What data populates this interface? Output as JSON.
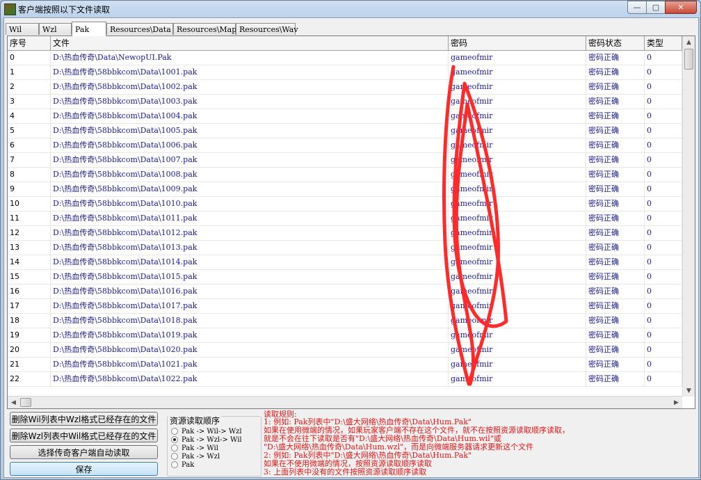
{
  "window": {
    "title": "客户端按照以下文件读取",
    "controls": {
      "minimize": "—",
      "maximize": "▢",
      "close": "✕"
    }
  },
  "tabs": [
    {
      "label": "Wil",
      "active": false
    },
    {
      "label": "Wzl",
      "active": false
    },
    {
      "label": "Pak",
      "active": true
    },
    {
      "label": "Resources\\Data",
      "active": false
    },
    {
      "label": "Resources\\Map",
      "active": false
    },
    {
      "label": "Resources\\Wav",
      "active": false
    }
  ],
  "grid": {
    "columns": [
      "序号",
      "文件",
      "密码",
      "密码状态",
      "类型"
    ],
    "rows": [
      [
        "0",
        "D:\\热血传奇\\Data\\NewopUI.Pak",
        "gameofmir",
        "密码正确",
        "0"
      ],
      [
        "1",
        "D:\\热血传奇\\58bbkcom\\Data\\1001.pak",
        "gameofmir",
        "密码正确",
        "0"
      ],
      [
        "2",
        "D:\\热血传奇\\58bbkcom\\Data\\1002.pak",
        "gameofmir",
        "密码正确",
        "0"
      ],
      [
        "3",
        "D:\\热血传奇\\58bbkcom\\Data\\1003.pak",
        "gameofmir",
        "密码正确",
        "0"
      ],
      [
        "4",
        "D:\\热血传奇\\58bbkcom\\Data\\1004.pak",
        "gameofmir",
        "密码正确",
        "0"
      ],
      [
        "5",
        "D:\\热血传奇\\58bbkcom\\Data\\1005.pak",
        "gameofmir",
        "密码正确",
        "0"
      ],
      [
        "6",
        "D:\\热血传奇\\58bbkcom\\Data\\1006.pak",
        "gameofmir",
        "密码正确",
        "0"
      ],
      [
        "7",
        "D:\\热血传奇\\58bbkcom\\Data\\1007.pak",
        "gameofmir",
        "密码正确",
        "0"
      ],
      [
        "8",
        "D:\\热血传奇\\58bbkcom\\Data\\1008.pak",
        "gameofmir",
        "密码正确",
        "0"
      ],
      [
        "9",
        "D:\\热血传奇\\58bbkcom\\Data\\1009.pak",
        "gameofmir",
        "密码正确",
        "0"
      ],
      [
        "10",
        "D:\\热血传奇\\58bbkcom\\Data\\1010.pak",
        "gameofmir",
        "密码正确",
        "0"
      ],
      [
        "11",
        "D:\\热血传奇\\58bbkcom\\Data\\1011.pak",
        "gameofmir",
        "密码正确",
        "0"
      ],
      [
        "12",
        "D:\\热血传奇\\58bbkcom\\Data\\1012.pak",
        "gameofmir",
        "密码正确",
        "0"
      ],
      [
        "13",
        "D:\\热血传奇\\58bbkcom\\Data\\1013.pak",
        "gameofmir",
        "密码正确",
        "0"
      ],
      [
        "14",
        "D:\\热血传奇\\58bbkcom\\Data\\1014.pak",
        "gameofmir",
        "密码正确",
        "0"
      ],
      [
        "15",
        "D:\\热血传奇\\58bbkcom\\Data\\1015.pak",
        "gameofmir",
        "密码正确",
        "0"
      ],
      [
        "16",
        "D:\\热血传奇\\58bbkcom\\Data\\1016.pak",
        "gameofmir",
        "密码正确",
        "0"
      ],
      [
        "17",
        "D:\\热血传奇\\58bbkcom\\Data\\1017.pak",
        "gameofmir",
        "密码正确",
        "0"
      ],
      [
        "18",
        "D:\\热血传奇\\58bbkcom\\Data\\1018.pak",
        "gameofmir",
        "密码正确",
        "0"
      ],
      [
        "19",
        "D:\\热血传奇\\58bbkcom\\Data\\1019.pak",
        "gameofmir",
        "密码正确",
        "0"
      ],
      [
        "20",
        "D:\\热血传奇\\58bbkcom\\Data\\1020.pak",
        "gameofmir",
        "密码正确",
        "0"
      ],
      [
        "21",
        "D:\\热血传奇\\58bbkcom\\Data\\1021.pak",
        "gameofmir",
        "密码正确",
        "0"
      ],
      [
        "22",
        "D:\\热血传奇\\58bbkcom\\Data\\1022.pak",
        "gameofmir",
        "密码正确",
        "0"
      ]
    ]
  },
  "buttons": {
    "delete_wil": "删除Wil列表中Wzl格式已经存在的文件",
    "delete_wzl": "删除Wzl列表中Wil格式已经存在的文件",
    "select_client": "选择传奇客户端自动读取",
    "save": "保存"
  },
  "resource_order": {
    "title": "资源读取顺序",
    "options": [
      {
        "label": "Pak -> Wil-> Wzl",
        "checked": false
      },
      {
        "label": "Pak -> Wzl-> Wil",
        "checked": true
      },
      {
        "label": "Pak -> Wil",
        "checked": false
      },
      {
        "label": "Pak -> Wzl",
        "checked": false
      },
      {
        "label": "Pak",
        "checked": false
      }
    ]
  },
  "rules": [
    "读取规则:",
    "1: 例如: Pak列表中\"D:\\盛大网络\\热血传奇\\Data\\Hum.Pak\"",
    "   如果在使用微端的情况，如果玩家客户端不存在这个文件，就不在按照资源读取顺序读取，",
    "   就是不会在往下读取是否有\"D:\\盛大网络\\热血传奇\\Data\\Hum.wil\"或",
    "   \"D:\\盛大网络\\热血传奇\\Data\\Hum.wzl\"，而是向微端服务器请求更新这个文件",
    "2: 例如: Pak列表中\"D:\\盛大网络\\热血传奇\\Data\\Hum.Pak\"",
    "   如果在不使用微端的情况，按照资源读取顺序读取",
    "3: 上面列表中没有的文件按照资源读取顺序读取"
  ],
  "colors": {
    "rule_text": "#e01515",
    "cell_text": "#1a1a8c",
    "annotation": "#ff2a2a"
  }
}
